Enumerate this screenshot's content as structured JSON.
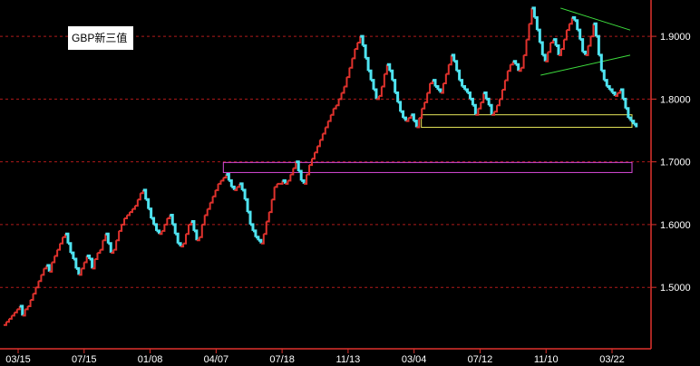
{
  "chart_data": {
    "type": "line",
    "title": "GBP新三值",
    "y_ticks": [
      {
        "value": 1.9,
        "label": "1.9000"
      },
      {
        "value": 1.8,
        "label": "1.8000"
      },
      {
        "value": 1.7,
        "label": "1.7000"
      },
      {
        "value": 1.6,
        "label": "1.6000"
      },
      {
        "value": 1.5,
        "label": "1.5000"
      }
    ],
    "x_ticks": [
      "03/15",
      "07/15",
      "01/08",
      "04/07",
      "07/18",
      "11/13",
      "03/04",
      "07/12",
      "11/10",
      "03/22"
    ],
    "ylim": [
      1.405,
      1.955
    ],
    "grid": true,
    "colors": {
      "up": "#e0322d",
      "down": "#4fe3f0",
      "grid": "#b01a1a",
      "axis": "#e0322d",
      "triangle": "#3ddc3d",
      "zone_high": "#e8e85a",
      "zone_low": "#d94ad9"
    },
    "series": [
      {
        "values": [
          1.44,
          1.445,
          1.45,
          1.455,
          1.46,
          1.465,
          1.47,
          1.455,
          1.465,
          1.47,
          1.48,
          1.49,
          1.5,
          1.51,
          1.52,
          1.53,
          1.535,
          1.525,
          1.54,
          1.55,
          1.56,
          1.57,
          1.58,
          1.585,
          1.57,
          1.555,
          1.545,
          1.53,
          1.52,
          1.53,
          1.54,
          1.55,
          1.545,
          1.53,
          1.545,
          1.555,
          1.56,
          1.575,
          1.585,
          1.57,
          1.555,
          1.56,
          1.575,
          1.59,
          1.6,
          1.61,
          1.615,
          1.62,
          1.625,
          1.63,
          1.64,
          1.65,
          1.655,
          1.64,
          1.625,
          1.61,
          1.6,
          1.59,
          1.585,
          1.59,
          1.6,
          1.61,
          1.615,
          1.6,
          1.585,
          1.57,
          1.565,
          1.57,
          1.585,
          1.6,
          1.605,
          1.59,
          1.575,
          1.58,
          1.6,
          1.615,
          1.625,
          1.635,
          1.645,
          1.655,
          1.665,
          1.67,
          1.675,
          1.68,
          1.67,
          1.66,
          1.655,
          1.66,
          1.665,
          1.655,
          1.64,
          1.62,
          1.6,
          1.59,
          1.58,
          1.575,
          1.57,
          1.585,
          1.605,
          1.62,
          1.64,
          1.66,
          1.665,
          1.665,
          1.67,
          1.665,
          1.67,
          1.68,
          1.69,
          1.7,
          1.685,
          1.67,
          1.665,
          1.68,
          1.695,
          1.705,
          1.715,
          1.725,
          1.735,
          1.745,
          1.755,
          1.765,
          1.775,
          1.785,
          1.79,
          1.8,
          1.81,
          1.82,
          1.835,
          1.85,
          1.865,
          1.88,
          1.89,
          1.9,
          1.885,
          1.865,
          1.845,
          1.83,
          1.815,
          1.8,
          1.805,
          1.82,
          1.84,
          1.855,
          1.845,
          1.83,
          1.81,
          1.795,
          1.78,
          1.77,
          1.765,
          1.77,
          1.775,
          1.765,
          1.755,
          1.77,
          1.785,
          1.795,
          1.81,
          1.825,
          1.83,
          1.82,
          1.815,
          1.81,
          1.825,
          1.84,
          1.855,
          1.87,
          1.86,
          1.845,
          1.83,
          1.82,
          1.815,
          1.81,
          1.8,
          1.79,
          1.775,
          1.785,
          1.795,
          1.81,
          1.8,
          1.79,
          1.775,
          1.78,
          1.79,
          1.8,
          1.815,
          1.83,
          1.845,
          1.855,
          1.86,
          1.855,
          1.845,
          1.85,
          1.87,
          1.895,
          1.92,
          1.945,
          1.93,
          1.91,
          1.89,
          1.87,
          1.86,
          1.875,
          1.89,
          1.895,
          1.885,
          1.87,
          1.88,
          1.895,
          1.91,
          1.92,
          1.93,
          1.925,
          1.91,
          1.895,
          1.875,
          1.87,
          1.885,
          1.9,
          1.92,
          1.9,
          1.87,
          1.845,
          1.83,
          1.82,
          1.815,
          1.81,
          1.805,
          1.81,
          1.815,
          1.8,
          1.785,
          1.77,
          1.765,
          1.76,
          1.755
        ]
      }
    ],
    "annotations": [
      {
        "type": "zone",
        "y": [
          1.755,
          1.775
        ],
        "x": [
          "03/04",
          "03/22"
        ],
        "color": "zone_high"
      },
      {
        "type": "zone",
        "y": [
          1.683,
          1.699
        ],
        "x": [
          "04/07",
          "03/22"
        ],
        "color": "zone_low"
      },
      {
        "type": "triangle",
        "x": [
          "11/10",
          "03/22"
        ],
        "y": [
          1.945,
          1.838
        ]
      }
    ]
  }
}
